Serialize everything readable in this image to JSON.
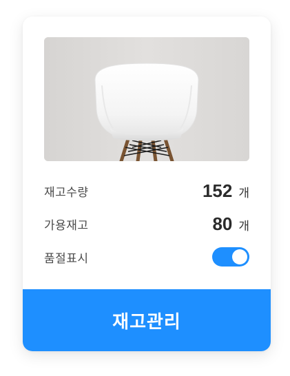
{
  "product": {
    "image_alt": "white chair"
  },
  "stock": {
    "quantity_label": "재고수량",
    "quantity_value": "152",
    "quantity_unit": "개",
    "available_label": "가용재고",
    "available_value": "80",
    "available_unit": "개",
    "soldout_label": "품절표시",
    "soldout_toggle_on": true
  },
  "actions": {
    "manage_label": "재고관리"
  },
  "colors": {
    "accent": "#1e8fff",
    "text": "#4a4a4a",
    "value_text": "#2b2b2b",
    "photo_bg": "#dcdad8"
  }
}
